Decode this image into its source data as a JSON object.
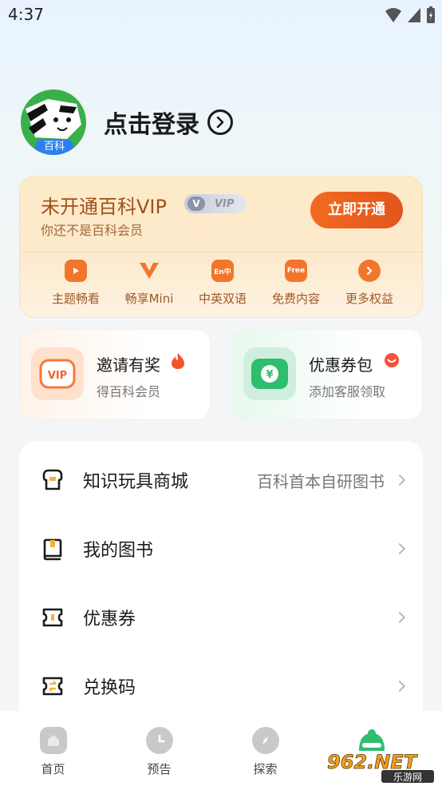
{
  "status_bar": {
    "time": "4:37"
  },
  "profile": {
    "avatar_badge": "百科",
    "login_text": "点击登录"
  },
  "vip": {
    "title": "未开通百科VIP",
    "subtitle": "你还不是百科会员",
    "tag_v": "V",
    "tag_text": "VIP",
    "button": "立即开通",
    "benefits": [
      {
        "label": "主题畅看",
        "icon": "tv-icon"
      },
      {
        "label": "畅享Mini",
        "icon": "v-logo-icon"
      },
      {
        "label": "中英双语",
        "icon": "translate-icon",
        "icon_text": "En中"
      },
      {
        "label": "免费内容",
        "icon": "free-icon",
        "icon_text": "Free"
      },
      {
        "label": "更多权益",
        "icon": "chevron-right-icon"
      }
    ]
  },
  "promos": {
    "invite": {
      "title": "邀请有奖",
      "subtitle": "得百科会员",
      "icon_text": "VIP"
    },
    "coupon_pack": {
      "title": "优惠券包",
      "subtitle": "添加客服领取",
      "icon_text": "¥"
    }
  },
  "menu": {
    "items": [
      {
        "label": "知识玩具商城",
        "extra": "百科首本自研图书"
      },
      {
        "label": "我的图书",
        "extra": ""
      },
      {
        "label": "优惠券",
        "extra": ""
      },
      {
        "label": "兑换码",
        "extra": ""
      }
    ]
  },
  "bottom_nav": {
    "items": [
      {
        "label": "首页"
      },
      {
        "label": "预告"
      },
      {
        "label": "探索"
      },
      {
        "label": ""
      }
    ]
  },
  "watermark": {
    "text": "962.NET",
    "sub": "乐游网"
  },
  "colors": {
    "accent": "#e9591f",
    "vip_text": "#a2501c",
    "green": "#39b04a"
  }
}
